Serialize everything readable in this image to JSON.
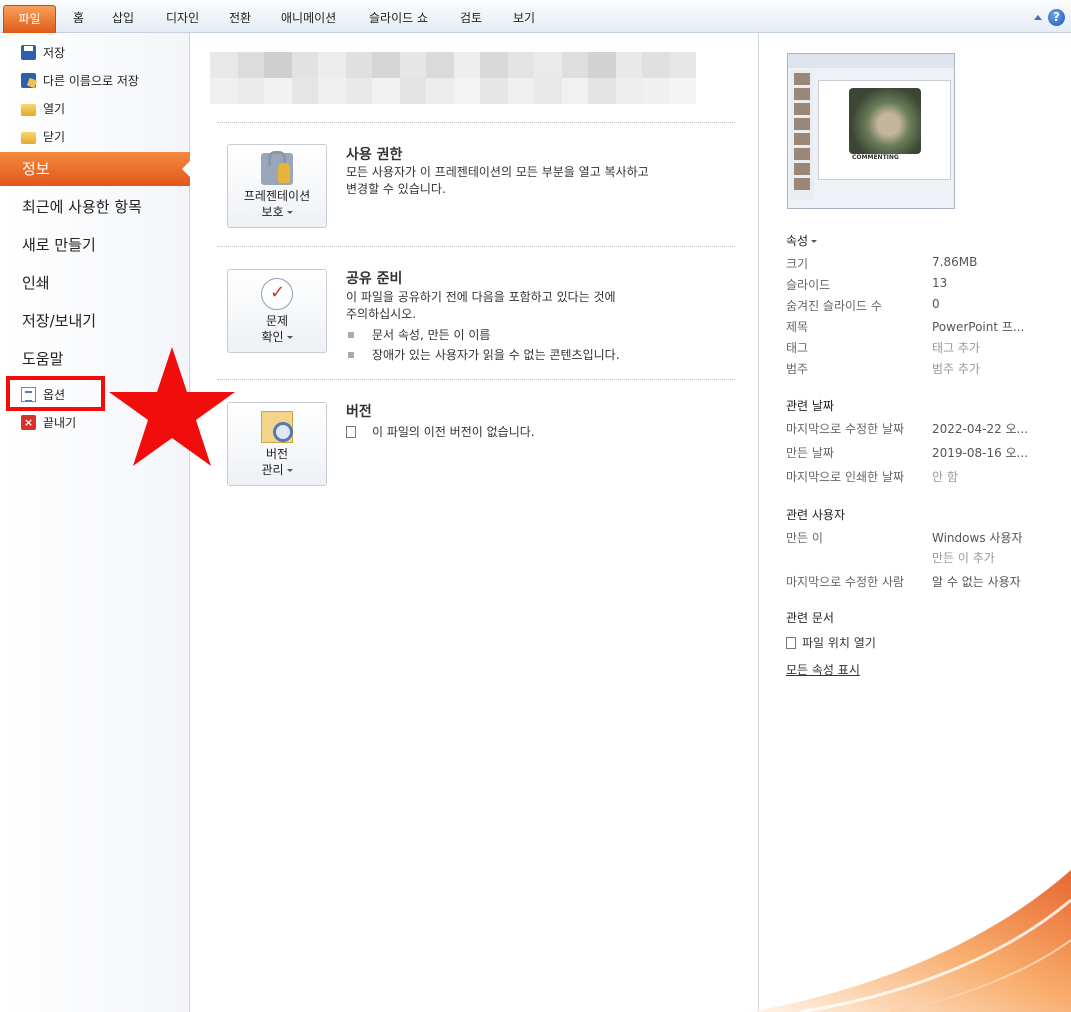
{
  "tabs": {
    "file": "파일",
    "items": [
      "홈",
      "삽입",
      "디자인",
      "전환",
      "애니메이션",
      "슬라이드 쇼",
      "검토",
      "보기"
    ],
    "help": "?"
  },
  "nav": {
    "save": "저장",
    "save_as": "다른 이름으로 저장",
    "open": "열기",
    "close": "닫기",
    "info": "정보",
    "recent": "최근에 사용한 항목",
    "new": "새로 만들기",
    "print": "인쇄",
    "save_send": "저장/보내기",
    "help": "도움말",
    "options": "옵션",
    "exit": "끝내기"
  },
  "permissions": {
    "button_line1": "프레젠테이션",
    "button_line2": "보호",
    "title": "사용 권한",
    "desc_line1": "모든 사용자가 이 프레젠테이션의 모든 부분을 열고 복사하고",
    "desc_line2": "변경할 수 있습니다."
  },
  "prepare": {
    "button_line1": "문제",
    "button_line2": "확인",
    "title": "공유 준비",
    "desc_line1": "이 파일을 공유하기 전에 다음을 포함하고 있다는 것에",
    "desc_line2": "주의하십시오.",
    "bullets": [
      "문서 속성, 만든 이 이름",
      "장애가 있는 사용자가 읽을 수 없는 콘텐츠입니다."
    ]
  },
  "versions": {
    "button_line1": "버전",
    "button_line2": "관리",
    "title": "버전",
    "desc": "이 파일의 이전 버전이 없습니다."
  },
  "properties": {
    "header": "속성",
    "rows": [
      {
        "key": "크기",
        "value": "7.86MB"
      },
      {
        "key": "슬라이드",
        "value": "13"
      },
      {
        "key": "숨겨진 슬라이드 수",
        "value": "0"
      },
      {
        "key": "제목",
        "value": "PowerPoint 프..."
      },
      {
        "key": "태그",
        "value": "태그 추가"
      },
      {
        "key": "범주",
        "value": "범주 추가"
      }
    ]
  },
  "dates": {
    "header": "관련 날짜",
    "rows": [
      {
        "key": "마지막으로 수정한 날짜",
        "value": "2022-04-22 오..."
      },
      {
        "key": "만든 날짜",
        "value": "2019-08-16 오..."
      },
      {
        "key": "마지막으로 인쇄한 날짜",
        "value": "안 함"
      }
    ]
  },
  "people": {
    "header": "관련 사용자",
    "author_key": "만든 이",
    "author_value": "Windows 사용자",
    "add_author": "만든 이 추가",
    "modified_by_key": "마지막으로 수정한 사람",
    "modified_by_value": "알 수 없는 사용자"
  },
  "documents": {
    "header": "관련 문서",
    "open_location": "파일 위치 열기",
    "show_all": "모든 속성 표시"
  },
  "thumbnail": {
    "caption": "COMMENTING"
  },
  "colors": {
    "accent": "#e2571a",
    "highlight": "#f20d0d"
  }
}
